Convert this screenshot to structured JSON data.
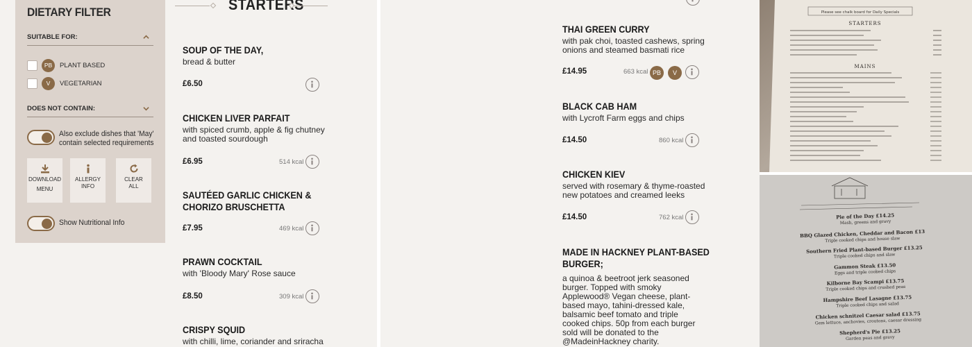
{
  "filter": {
    "title": "DIETARY FILTER",
    "suitable_label": "SUITABLE FOR:",
    "options": [
      {
        "badge": "PB",
        "label": "PLANT BASED"
      },
      {
        "badge": "V",
        "label": "VEGETARIAN"
      }
    ],
    "not_contain_label": "DOES NOT CONTAIN:",
    "exclude_toggle_label_1": "Also exclude dishes that 'May'",
    "exclude_toggle_label_2": "contain selected requirements",
    "tiles": [
      {
        "line1": "DOWNLOAD",
        "line2": "MENU"
      },
      {
        "line1": "ALLERGY",
        "line2": "INFO"
      },
      {
        "line1": "CLEAR",
        "line2": "ALL"
      }
    ],
    "nutrition_toggle_label": "Show Nutritional Info",
    "accent_color": "#8a6a47"
  },
  "starters": {
    "heading": "STARTERS",
    "dishes": [
      {
        "name": "SOUP OF THE DAY,",
        "desc_1": "bread & butter",
        "desc_2": "",
        "price": "£6.50",
        "kcal": ""
      },
      {
        "name": "CHICKEN LIVER PARFAIT",
        "desc_1": "with spiced crumb, apple & fig chutney",
        "desc_2": "and toasted sourdough",
        "price": "£6.95",
        "kcal": "514 kcal"
      },
      {
        "name_1": "SAUTÉED GARLIC CHICKEN &",
        "name_2": "CHORIZO BRUSCHETTA",
        "price": "£7.95",
        "kcal": "469 kcal"
      },
      {
        "name": "PRAWN COCKTAIL",
        "desc_1": "with 'Bloody Mary' Rose sauce",
        "desc_2": "",
        "price": "£8.50",
        "kcal": "309 kcal"
      },
      {
        "name": "CRISPY SQUID",
        "desc_1": "with chilli, lime, coriander and sriracha",
        "desc_2": "",
        "price": "",
        "kcal": ""
      }
    ]
  },
  "mains": {
    "dishes": [
      {
        "name": "THAI GREEN CURRY",
        "desc_1": "with pak choi, toasted cashews, spring",
        "desc_2": "onions and steamed basmati rice",
        "price": "£14.95",
        "kcal": "663 kcal",
        "badges": [
          "PB",
          "V"
        ]
      },
      {
        "name": "BLACK CAB HAM",
        "desc_1": "with Lycroft Farm eggs and chips",
        "desc_2": "",
        "price": "£14.50",
        "kcal": "860 kcal"
      },
      {
        "name": "CHICKEN KIEV",
        "desc_1": "served with rosemary & thyme-roasted",
        "desc_2": "new potatoes and creamed leeks",
        "price": "£14.50",
        "kcal": "762 kcal"
      },
      {
        "name_1": "MADE IN HACKNEY PLANT-BASED",
        "name_2": "BURGER;",
        "desc_lines": [
          "a quinoa & beetroot jerk seasoned",
          "burger. Topped with smoky",
          "Applewood® Vegan cheese, plant-",
          "based mayo, tahini-dressed kale,",
          "balsamic beef tomato and triple",
          "cooked chips. 50p from each burger",
          "sold will be donated to the",
          "@MadeinHackney charity."
        ]
      }
    ]
  },
  "photos": {
    "photo1_header": "Please see chalk board for Daily Specials",
    "photo1_starters": "STARTERS",
    "photo1_mains": "MAINS",
    "photo2_items": [
      {
        "name": "Pie of the Day £14.25",
        "desc": "Mash, greens and gravy"
      },
      {
        "name": "BBQ Glazed Chicken, Cheddar and Bacon £13",
        "desc": "Triple cooked chips and house slaw"
      },
      {
        "name": "Southern Fried Plant-based Burger £13.25",
        "desc": "Triple cooked chips and slaw"
      },
      {
        "name": "Gammon Steak £13.50",
        "desc": "Eggs and triple cooked chips"
      },
      {
        "name": "Kilborne Bay Scampi £13.75",
        "desc": "Triple cooked chips and crushed peas"
      },
      {
        "name": "Hampshire Beef Lasagne £13.75",
        "desc": "Triple cooked chips and salad"
      },
      {
        "name": "Chicken schnitzel Caesar salad £13.75",
        "desc": "Gem lettuce, anchovies, croutons, caesar dressing"
      },
      {
        "name": "Shepherd's Pie £13.25",
        "desc": "Garden peas and gravy"
      }
    ]
  }
}
